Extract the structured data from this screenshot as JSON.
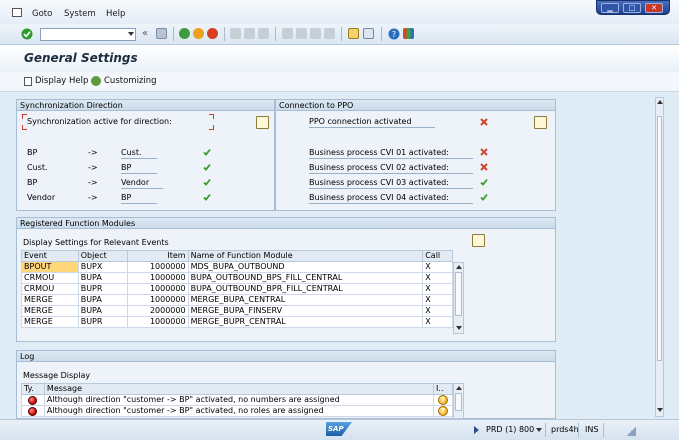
{
  "menu": {
    "items": [
      "Goto",
      "System",
      "Help"
    ]
  },
  "page": {
    "title": "General Settings"
  },
  "app_toolbar": {
    "display_help": "Display Help",
    "customizing": "Customizing"
  },
  "sync": {
    "header": "Synchronization Direction",
    "active_label": "Synchronization active for direction:",
    "rows": [
      {
        "from": "BP",
        "arrow": "->",
        "to": "Cust.",
        "status": "ok"
      },
      {
        "from": "Cust.",
        "arrow": "->",
        "to": "BP",
        "status": "ok"
      },
      {
        "from": "BP",
        "arrow": "->",
        "to": "Vendor",
        "status": "ok"
      },
      {
        "from": "Vendor",
        "arrow": "->",
        "to": "BP",
        "status": "ok"
      }
    ]
  },
  "ppo": {
    "header": "Connection to PPO",
    "connection_label": "PPO connection activated",
    "connection_status": "error",
    "rows": [
      {
        "label": "Business process CVI 01 activated:",
        "status": "error"
      },
      {
        "label": "Business process CVI 02 activated:",
        "status": "error"
      },
      {
        "label": "Business process CVI 03 activated:",
        "status": "ok"
      },
      {
        "label": "Business process CVI 04 activated:",
        "status": "ok"
      }
    ]
  },
  "functions": {
    "header": "Registered Function Modules",
    "subheader": "Display Settings for Relevant Events",
    "columns": [
      "Event",
      "Object",
      "Item",
      "Name of Function Module",
      "Call"
    ],
    "rows": [
      [
        "BPOUT",
        "BUPX",
        "1000000",
        "MDS_BUPA_OUTBOUND",
        "X"
      ],
      [
        "CRMOU",
        "BUPA",
        "1000000",
        "BUPA_OUTBOUND_BPS_FILL_CENTRAL",
        "X"
      ],
      [
        "CRMOU",
        "BUPR",
        "1000000",
        "BUPA_OUTBOUND_BPR_FILL_CENTRAL",
        "X"
      ],
      [
        "MERGE",
        "BUPA",
        "1000000",
        "MERGE_BUPA_CENTRAL",
        "X"
      ],
      [
        "MERGE",
        "BUPA",
        "2000000",
        "MERGE_BUPA_FINSERV",
        "X"
      ],
      [
        "MERGE",
        "BUPR",
        "1000000",
        "MERGE_BUPR_CENTRAL",
        "X"
      ]
    ]
  },
  "log": {
    "header": "Log",
    "subheader": "Message Display",
    "columns": [
      "Ty.",
      "Message",
      "I.."
    ],
    "rows": [
      {
        "message": "Although direction \"customer -> BP\" activated, no numbers are assigned"
      },
      {
        "message": "Although direction \"customer -> BP\" activated, no roles are assigned"
      }
    ]
  },
  "status": {
    "system": "PRD (1) 800",
    "server": "prds4h",
    "mode": "INS"
  },
  "colors": {
    "ok": "#3a9a2a",
    "error": "#d2452a",
    "accent": "#1e3f8f"
  }
}
